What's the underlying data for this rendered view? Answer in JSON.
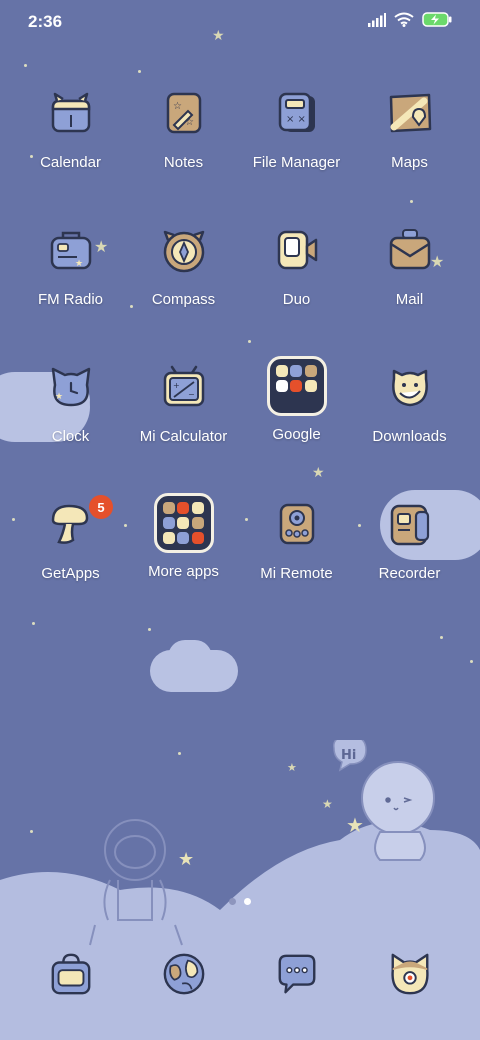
{
  "status_bar": {
    "time": "2:36",
    "icons": [
      "signal-icon",
      "wifi-icon",
      "battery-charging-icon"
    ]
  },
  "apps": [
    {
      "label": "Calendar",
      "icon": "calendar-icon"
    },
    {
      "label": "Notes",
      "icon": "notes-icon"
    },
    {
      "label": "File Manager",
      "icon": "file-manager-icon"
    },
    {
      "label": "Maps",
      "icon": "maps-icon"
    },
    {
      "label": "FM Radio",
      "icon": "fm-radio-icon"
    },
    {
      "label": "Compass",
      "icon": "compass-icon"
    },
    {
      "label": "Duo",
      "icon": "duo-icon"
    },
    {
      "label": "Mail",
      "icon": "mail-icon"
    },
    {
      "label": "Clock",
      "icon": "clock-icon"
    },
    {
      "label": "Mi Calculator",
      "icon": "calculator-icon"
    },
    {
      "label": "Google",
      "icon": "google-folder-icon"
    },
    {
      "label": "Downloads",
      "icon": "downloads-icon"
    },
    {
      "label": "GetApps",
      "icon": "getapps-icon",
      "badge": "5"
    },
    {
      "label": "More apps",
      "icon": "more-apps-folder-icon"
    },
    {
      "label": "Mi Remote",
      "icon": "mi-remote-icon"
    },
    {
      "label": "Recorder",
      "icon": "recorder-icon"
    }
  ],
  "wallpaper": {
    "speech_bubble": "Hi"
  },
  "dock": [
    {
      "icon": "phone-bag-icon"
    },
    {
      "icon": "browser-globe-icon"
    },
    {
      "icon": "messages-icon"
    },
    {
      "icon": "camera-cat-icon"
    }
  ],
  "colors": {
    "background": "#6673a7",
    "icon_outline": "#2d3550",
    "icon_cream": "#f4e7b8",
    "icon_blue": "#8ea0d6",
    "icon_tan": "#c9a77b",
    "badge": "#e5502b"
  }
}
